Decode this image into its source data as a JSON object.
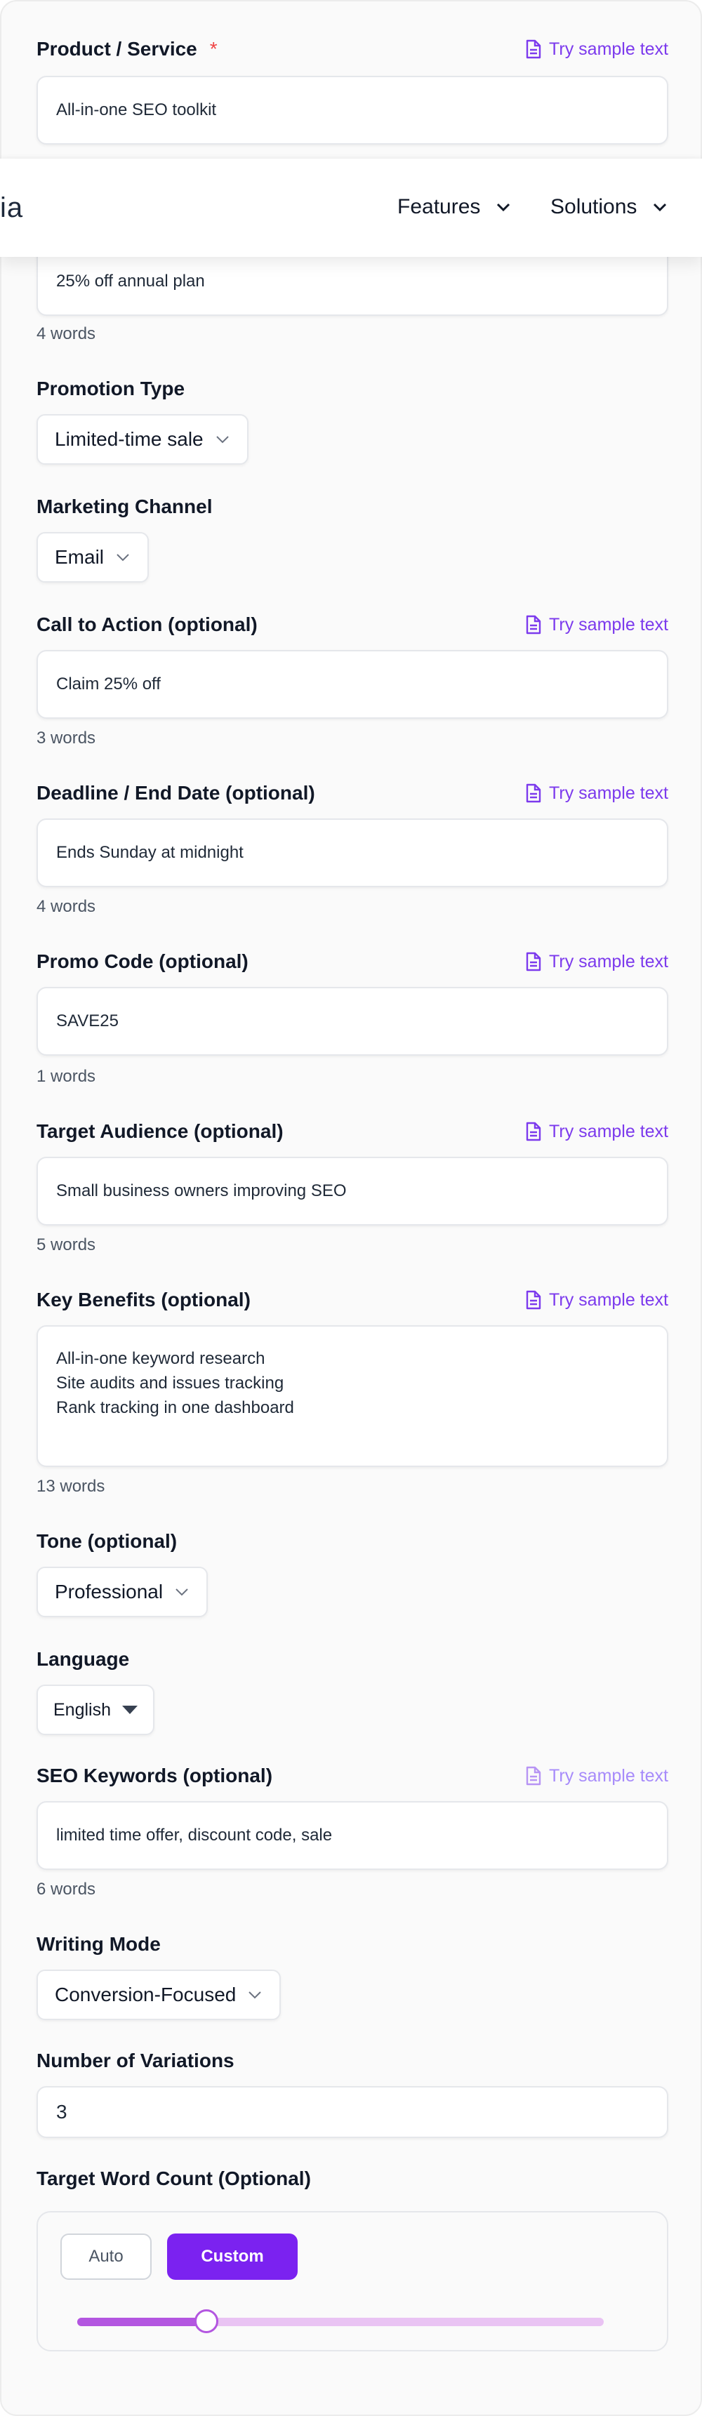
{
  "sample_label": "Try sample text",
  "product": {
    "label": "Product / Service",
    "required_mark": "*",
    "value": "All-in-one SEO toolkit"
  },
  "navbar": {
    "logo_fragment": "ia",
    "items": [
      "Features",
      "Solutions"
    ]
  },
  "offer": {
    "value": "25% off annual plan",
    "word_count": "4 words"
  },
  "promotion_type": {
    "label": "Promotion Type",
    "value": "Limited-time sale"
  },
  "marketing_channel": {
    "label": "Marketing Channel",
    "value": "Email"
  },
  "cta": {
    "label": "Call to Action (optional)",
    "value": "Claim 25% off",
    "word_count": "3 words"
  },
  "deadline": {
    "label": "Deadline / End Date (optional)",
    "value": "Ends Sunday at midnight",
    "word_count": "4 words"
  },
  "promo_code": {
    "label": "Promo Code (optional)",
    "value": "SAVE25",
    "word_count": "1 words"
  },
  "audience": {
    "label": "Target Audience (optional)",
    "value": "Small business owners improving SEO",
    "word_count": "5 words"
  },
  "benefits": {
    "label": "Key Benefits (optional)",
    "lines": [
      "All-in-one keyword research",
      "Site audits and issues tracking",
      "Rank tracking in one dashboard"
    ],
    "word_count": "13 words"
  },
  "tone": {
    "label": "Tone (optional)",
    "value": "Professional"
  },
  "language": {
    "label": "Language",
    "value": "English"
  },
  "seo_keywords": {
    "label": "SEO Keywords (optional)",
    "value": "limited time offer, discount code, sale",
    "word_count": "6 words"
  },
  "writing_mode": {
    "label": "Writing Mode",
    "value": "Conversion-Focused"
  },
  "variations": {
    "label": "Number of Variations",
    "value": "3"
  },
  "target_word_count": {
    "label": "Target Word Count (Optional)",
    "auto_label": "Auto",
    "custom_label": "Custom",
    "mode": "Custom",
    "slider_level": 0.245
  },
  "colors": {
    "accent": "#7c3aed",
    "button": "#7b22f0",
    "slider_fill": "#b356e0",
    "slider_track": "#e9c3f3",
    "required": "#ef4444"
  }
}
